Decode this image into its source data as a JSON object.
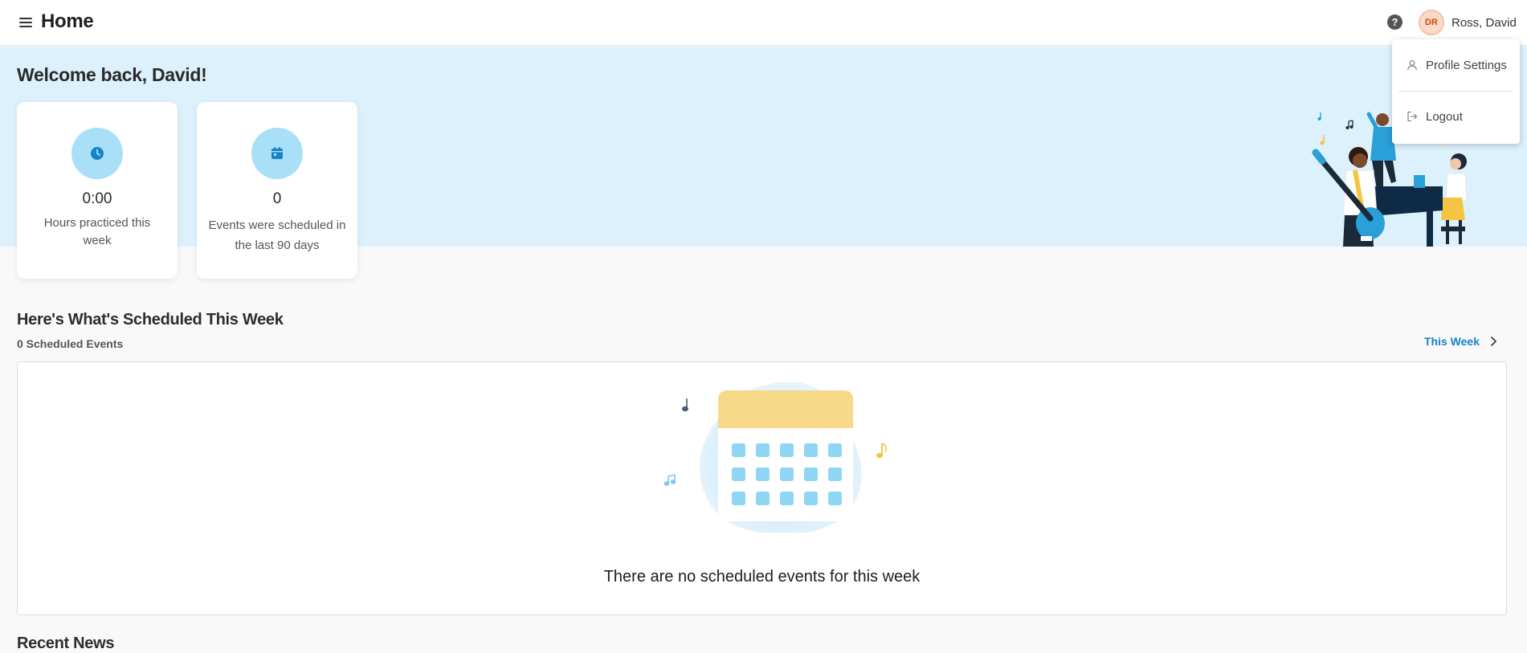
{
  "header": {
    "title": "Home",
    "help_icon": "question-circle-icon",
    "user": {
      "initials": "DR",
      "name": "Ross, David"
    }
  },
  "user_menu": {
    "items": [
      {
        "label": "Profile Settings",
        "icon": "person-icon"
      },
      {
        "label": "Logout",
        "icon": "logout-icon"
      }
    ]
  },
  "hero": {
    "welcome": "Welcome back, David!",
    "stats": [
      {
        "value": "0:00",
        "label": "Hours practiced this week",
        "icon": "clock-icon"
      },
      {
        "value": "0",
        "label": "Events were scheduled in the last 90 days",
        "icon": "calendar-icon"
      }
    ]
  },
  "schedule": {
    "title": "Here's What's Scheduled This Week",
    "count_text": "0 Scheduled Events",
    "range_link": "This Week",
    "empty_message": "There are no scheduled events for this week"
  },
  "news": {
    "title": "Recent News"
  },
  "colors": {
    "hero_bg": "#ddf1fd",
    "accent": "#1683c7",
    "icon_circle": "#a9dff7",
    "avatar_bg": "#fbd9c8"
  }
}
